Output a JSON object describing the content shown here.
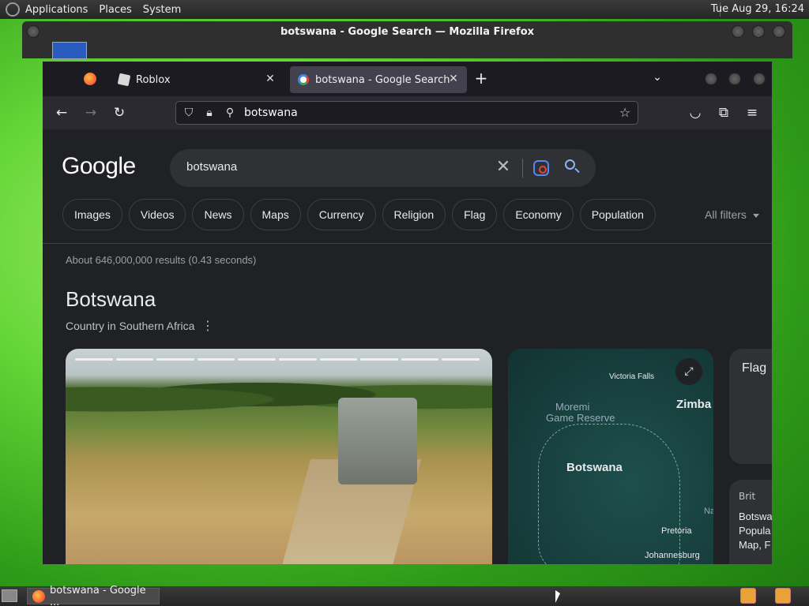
{
  "top_panel": {
    "menus": [
      "Applications",
      "Places",
      "System"
    ],
    "clock": "Tue Aug 29, 16:24"
  },
  "outer_window": {
    "title": "botswana - Google Search — Mozilla Firefox"
  },
  "browser": {
    "tabs": [
      {
        "label": "Roblox",
        "active": false
      },
      {
        "label": "botswana - Google Search",
        "active": true
      }
    ],
    "url": "botswana"
  },
  "google": {
    "logo": "Google",
    "query": "botswana",
    "chips": [
      "Images",
      "Videos",
      "News",
      "Maps",
      "Currency",
      "Religion",
      "Flag",
      "Economy",
      "Population"
    ],
    "all_filters": "All filters",
    "results_count": "About 646,000,000 results (0.43 seconds)",
    "kp_title": "Botswana",
    "kp_subtitle": "Country in Southern Africa",
    "map_labels": {
      "victoria_falls": "Victoria Falls",
      "moremi": "Moremi",
      "game_reserve": "Game Reserve",
      "zimba": "Zimba",
      "botswana": "Botswana",
      "na": "Na",
      "pretoria": "Pretoria",
      "johannesburg": "Johannesburg"
    },
    "flag_card_title": "Flag",
    "brit_card": {
      "source": "Brit",
      "lines": [
        "Botswa",
        "Popula",
        "Map, F"
      ]
    }
  },
  "taskbar": {
    "task_label": "botswana - Google ..."
  }
}
